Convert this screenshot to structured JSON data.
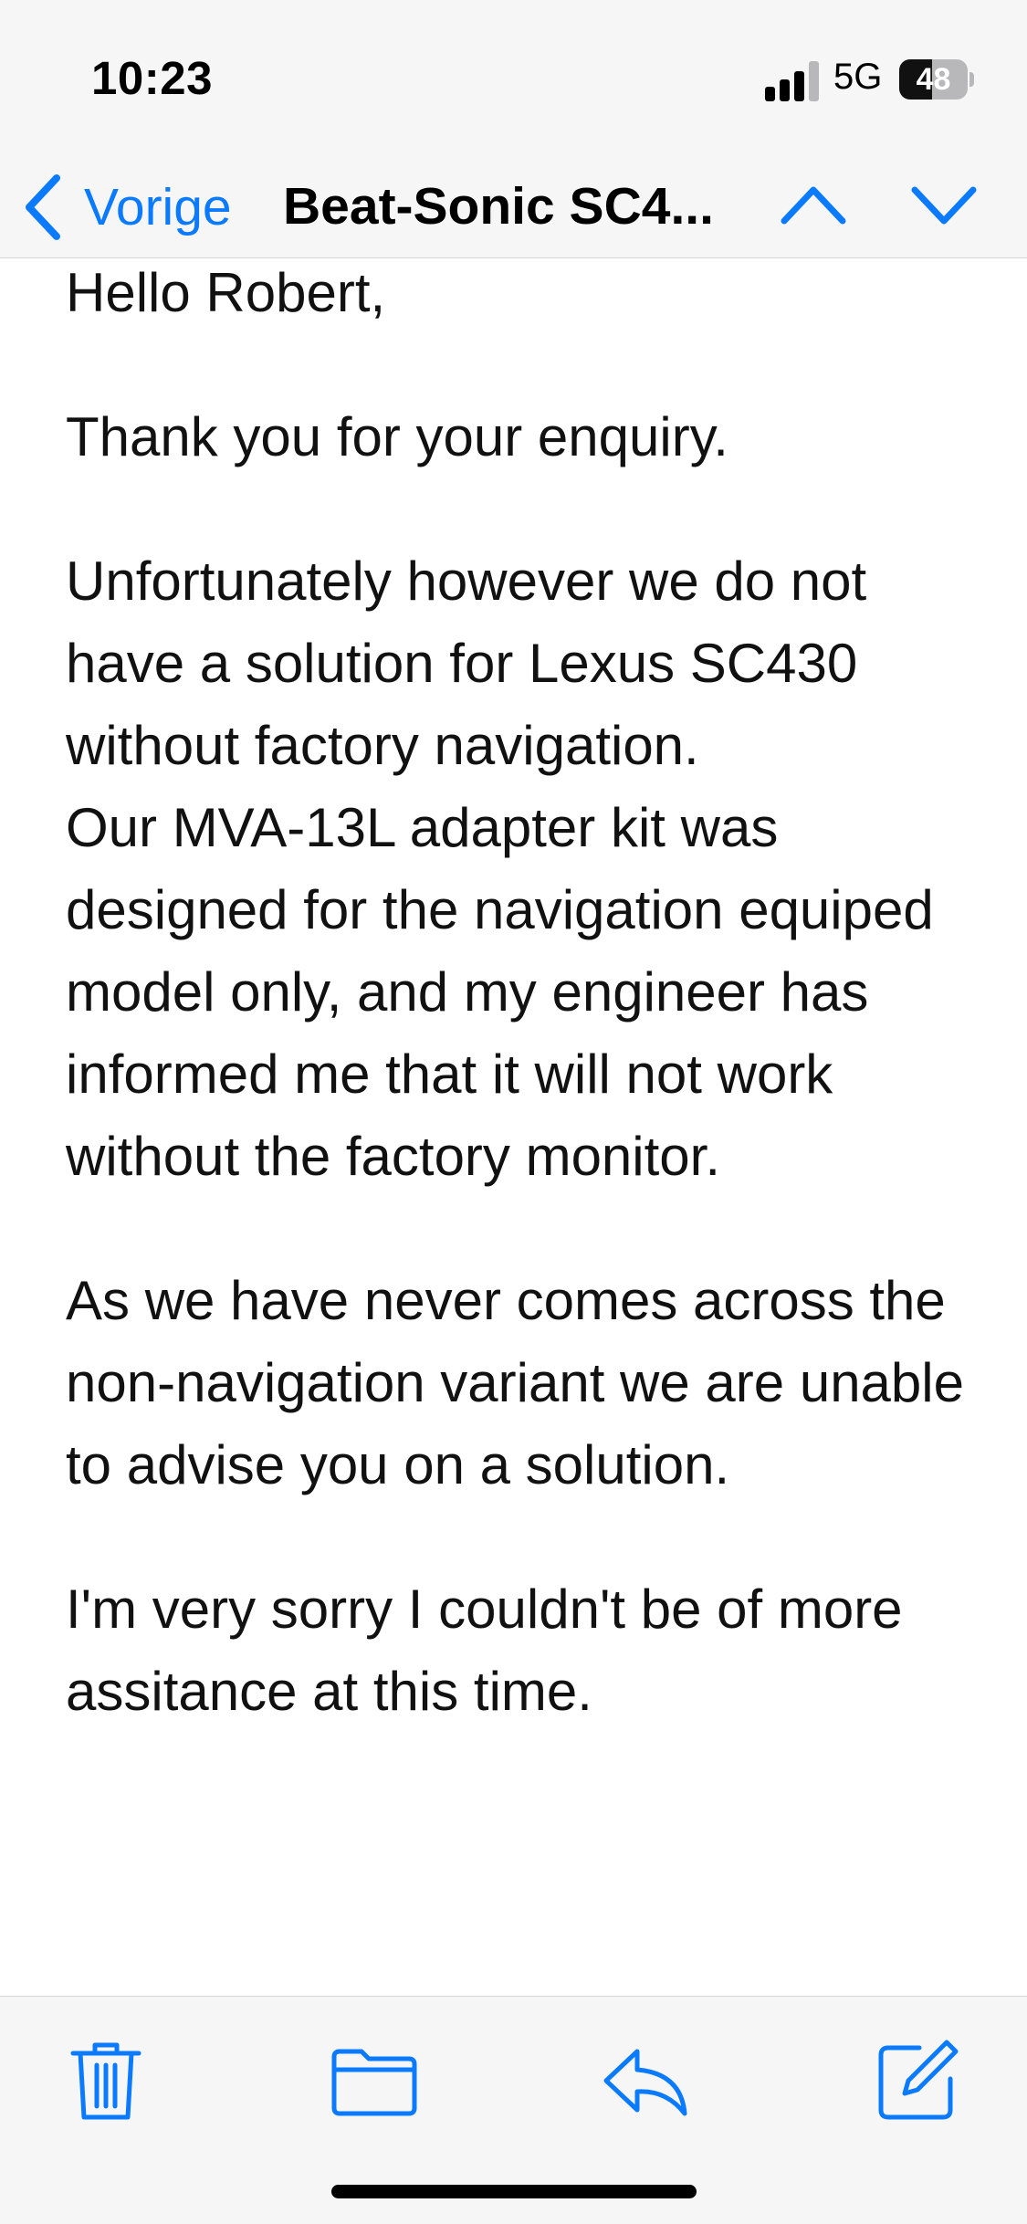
{
  "status_bar": {
    "time": "10:23",
    "network": "5G",
    "battery_level": "48",
    "battery_fraction": 0.48,
    "signal_icon": "cellular-signal-icon",
    "battery_icon": "battery-icon"
  },
  "nav": {
    "back_label": "Vorige",
    "title": "Beat-Sonic SC4...",
    "back_icon": "chevron-left-icon",
    "prev_icon": "chevron-up-icon",
    "next_icon": "chevron-down-icon"
  },
  "email": {
    "paragraphs": [
      "Hello Robert,",
      "Thank you for your enquiry.",
      "Unfortunately however we do not have a solution for Lexus SC430 without factory navigation.",
      "Our MVA-13L adapter kit was designed for the navigation equiped model only, and my engineer has informed me that it will not work without the factory monitor.",
      "As we have never comes across the non-navigation variant we are unable to advise you on a solution.",
      "I'm very sorry I couldn't be of more assitance at this time."
    ]
  },
  "toolbar": {
    "icons": [
      "trash-icon",
      "folder-icon",
      "reply-icon",
      "compose-icon"
    ]
  },
  "colors": {
    "accent": "#0a7aff",
    "bar_background": "#f6f6f7",
    "text": "#111111"
  }
}
